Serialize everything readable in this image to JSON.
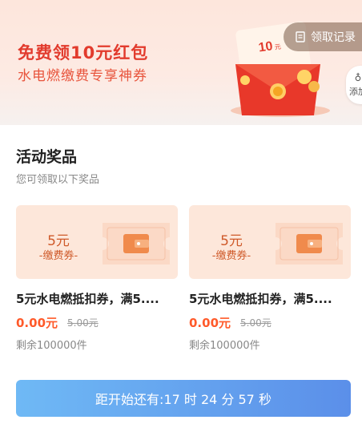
{
  "banner": {
    "title": "免费领10元红包",
    "subtitle": "水电燃缴费专享神券",
    "packet_text": "10",
    "packet_unit": "元",
    "records_label": "领取记录",
    "add_label": "添加"
  },
  "section": {
    "title": "活动奖品",
    "subtitle": "您可领取以下奖品"
  },
  "prizes": [
    {
      "amount": "5元",
      "kind": "缴费券",
      "name": "5元水电燃抵扣券，满5....",
      "price": "0.00元",
      "original": "5.00元",
      "remaining": "剩余100000件"
    },
    {
      "amount": "5元",
      "kind": "缴费券",
      "name": "5元水电燃抵扣券，满5....",
      "price": "0.00元",
      "original": "5.00元",
      "remaining": "剩余100000件"
    }
  ],
  "countdown": {
    "label": "距开始还有:17 时 24 分 57 秒"
  },
  "colors": {
    "accent_red": "#e23b2d",
    "price": "#ff5a2a",
    "button_start": "#6fb9f5",
    "button_end": "#5b8fe9"
  }
}
